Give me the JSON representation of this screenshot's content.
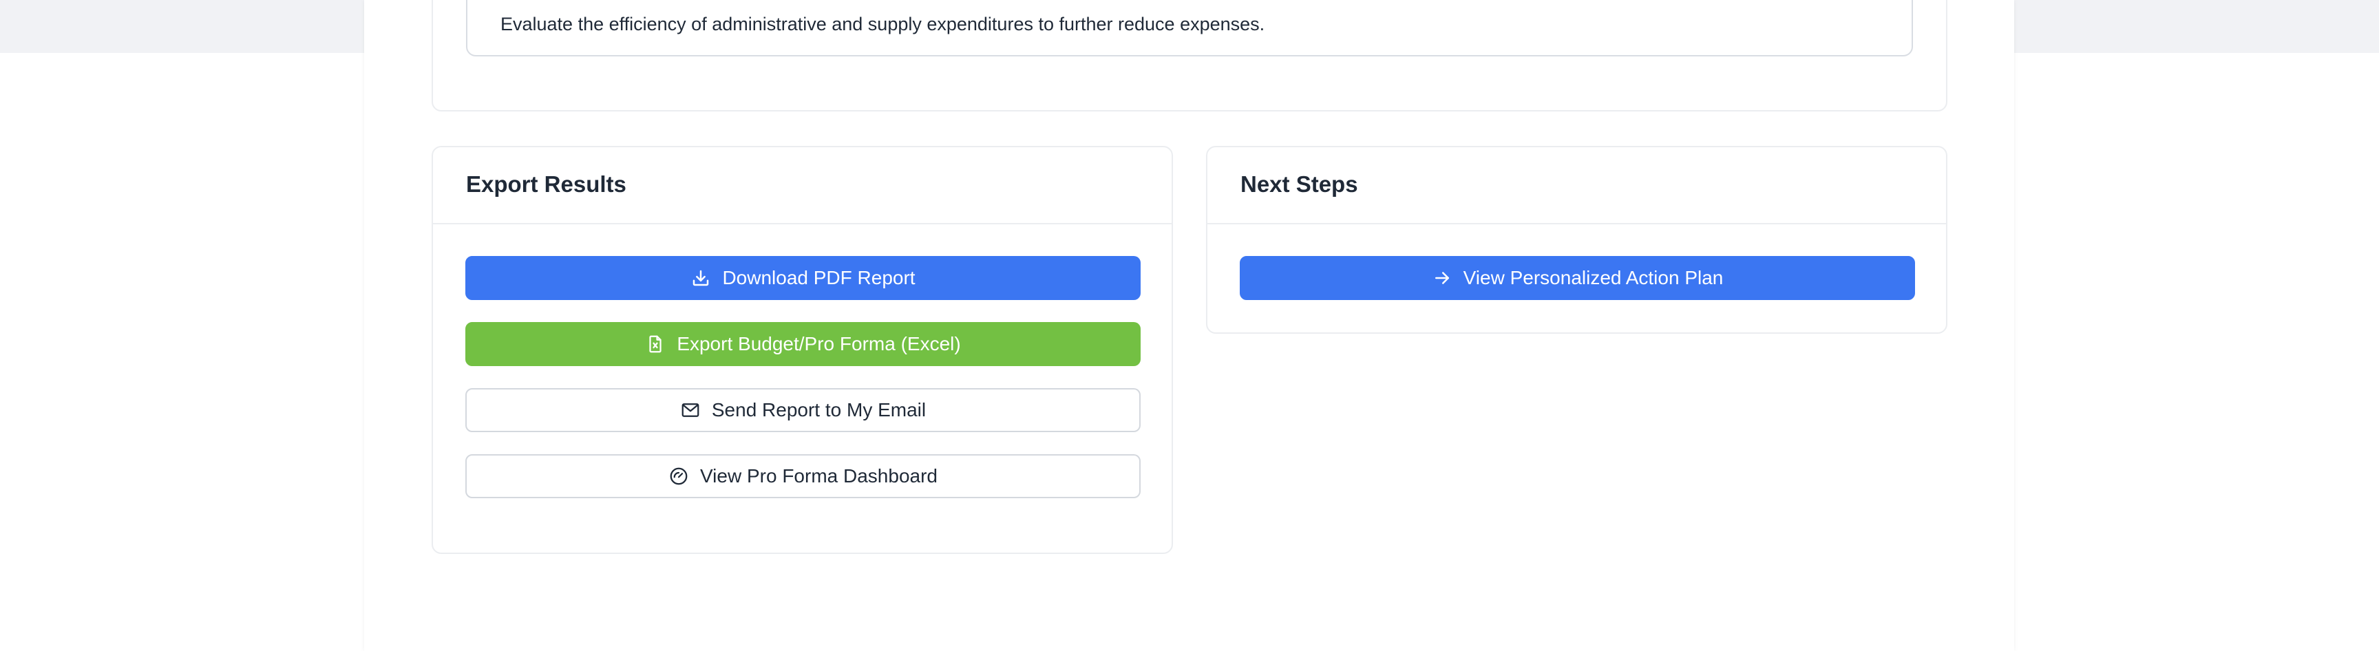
{
  "recommendation": {
    "text": "Evaluate the efficiency of administrative and supply expenditures to further reduce expenses."
  },
  "export_results": {
    "title": "Export Results",
    "download_pdf_label": "Download PDF Report",
    "export_excel_label": "Export Budget/Pro Forma (Excel)",
    "send_email_label": "Send Report to My Email",
    "view_dashboard_label": "View Pro Forma Dashboard"
  },
  "next_steps": {
    "title": "Next Steps",
    "action_plan_label": "View Personalized Action Plan"
  },
  "icons": {
    "download": "download-icon",
    "excel": "excel-file-icon",
    "email": "mail-icon",
    "dashboard": "gauge-icon",
    "arrow": "arrow-right-icon"
  },
  "colors": {
    "primary": "#3b76f2",
    "success": "#73c043",
    "border": "#d4d8de",
    "background_band": "#f1f2f5"
  }
}
